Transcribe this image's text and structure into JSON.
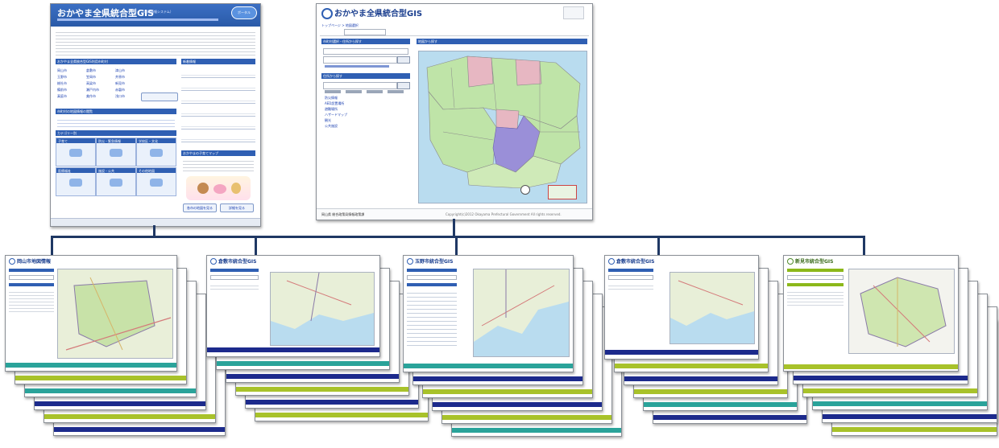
{
  "top_left": {
    "title": "おかやま全県統合型GIS",
    "subtitle_small": "（地理情報システム）",
    "badge": "ポータル",
    "sections": [
      "おかやま全県統合型GIS利用市町村",
      "新着情報",
      "市町村の地図情報の閲覧",
      "カテゴリー別",
      "おかやまの子育てマップ"
    ],
    "municipalities": [
      "岡山市",
      "倉敷市",
      "津山市",
      "玉野市",
      "笠岡市",
      "井原市",
      "総社市",
      "高梁市",
      "新見市",
      "備前市",
      "瀬戸内市",
      "赤磐市",
      "真庭市",
      "美作市",
      "浅口市"
    ],
    "categories": [
      "子育て",
      "防災・緊急情報",
      "学校区・文化",
      "医療福祉",
      "施設・公共",
      "その他地図"
    ],
    "footer_buttons": [
      "各市の地図を見る",
      "詳細を見る"
    ]
  },
  "top_right": {
    "title": "おかやま全県統合型GIS",
    "breadcrumb": "トップページ > 地図選択",
    "left_panels": [
      "市町村選択・住所から探す",
      "住所から探す",
      "地図の種類を選ぶ"
    ],
    "layer_links": [
      "防災情報",
      "AED設置場所",
      "避難場所",
      "ハザードマップ",
      "観光",
      "公共施設"
    ],
    "map_panel": "地図から探す",
    "footer": "岡山県 総合政策局情報政策課",
    "copyright": "Copyright(c)2012 Okayama Prefectural Government All rights reserved."
  },
  "bottom_screens": [
    {
      "title": "岡山市地図情報",
      "accent": "#2f5fb3"
    },
    {
      "title": "倉敷市統合型GIS",
      "accent": "#2f5fb3"
    },
    {
      "title": "玉野市統合型GIS",
      "accent": "#2f5fb3"
    },
    {
      "title": "倉敷市統合型GIS",
      "accent": "#2f5fb3"
    },
    {
      "title": "新見市統合型GIS",
      "accent": "#8cb81a"
    }
  ],
  "colors": {
    "connector": "#1f3864",
    "header_blue": "#2f5fb3",
    "green_band": "#a8c22a",
    "teal_band": "#2aa39a",
    "navy_band": "#1c2a8c",
    "map_green": "#bfe4a8",
    "map_purple": "#9a8fd8",
    "map_pink": "#e7b7c2",
    "sea": "#b9dcef"
  }
}
